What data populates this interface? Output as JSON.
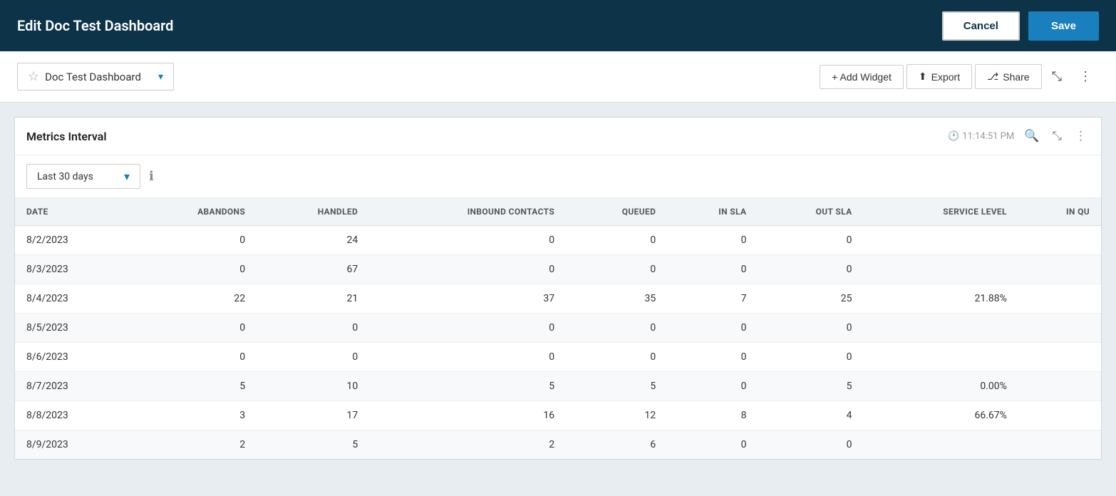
{
  "header": {
    "title": "Edit Doc Test Dashboard",
    "cancel_label": "Cancel",
    "save_label": "Save"
  },
  "toolbar": {
    "dashboard_name": "Doc Test Dashboard",
    "add_widget_label": "+ Add Widget",
    "export_label": "Export",
    "share_label": "Share"
  },
  "widget": {
    "title": "Metrics Interval",
    "time": "11:14:51 PM",
    "interval_label": "Last 30 days",
    "table": {
      "columns": [
        "DATE",
        "ABANDONS",
        "HANDLED",
        "INBOUND CONTACTS",
        "QUEUED",
        "IN SLA",
        "OUT SLA",
        "SERVICE LEVEL",
        "IN QU"
      ],
      "rows": [
        {
          "date": "8/2/2023",
          "abandons": 0,
          "handled": 24,
          "inbound": 0,
          "queued": 0,
          "in_sla": 0,
          "out_sla": 0,
          "service_level": ""
        },
        {
          "date": "8/3/2023",
          "abandons": 0,
          "handled": 67,
          "inbound": 0,
          "queued": 0,
          "in_sla": 0,
          "out_sla": 0,
          "service_level": ""
        },
        {
          "date": "8/4/2023",
          "abandons": 22,
          "handled": 21,
          "inbound": 37,
          "queued": 35,
          "in_sla": 7,
          "out_sla": 25,
          "service_level": "21.88%"
        },
        {
          "date": "8/5/2023",
          "abandons": 0,
          "handled": 0,
          "inbound": 0,
          "queued": 0,
          "in_sla": 0,
          "out_sla": 0,
          "service_level": ""
        },
        {
          "date": "8/6/2023",
          "abandons": 0,
          "handled": 0,
          "inbound": 0,
          "queued": 0,
          "in_sla": 0,
          "out_sla": 0,
          "service_level": ""
        },
        {
          "date": "8/7/2023",
          "abandons": 5,
          "handled": 10,
          "inbound": 5,
          "queued": 5,
          "in_sla": 0,
          "out_sla": 5,
          "service_level": "0.00%"
        },
        {
          "date": "8/8/2023",
          "abandons": 3,
          "handled": 17,
          "inbound": 16,
          "queued": 12,
          "in_sla": 8,
          "out_sla": 4,
          "service_level": "66.67%"
        },
        {
          "date": "8/9/2023",
          "abandons": 2,
          "handled": 5,
          "inbound": 2,
          "queued": 6,
          "in_sla": 0,
          "out_sla": 0,
          "service_level": ""
        }
      ]
    }
  }
}
